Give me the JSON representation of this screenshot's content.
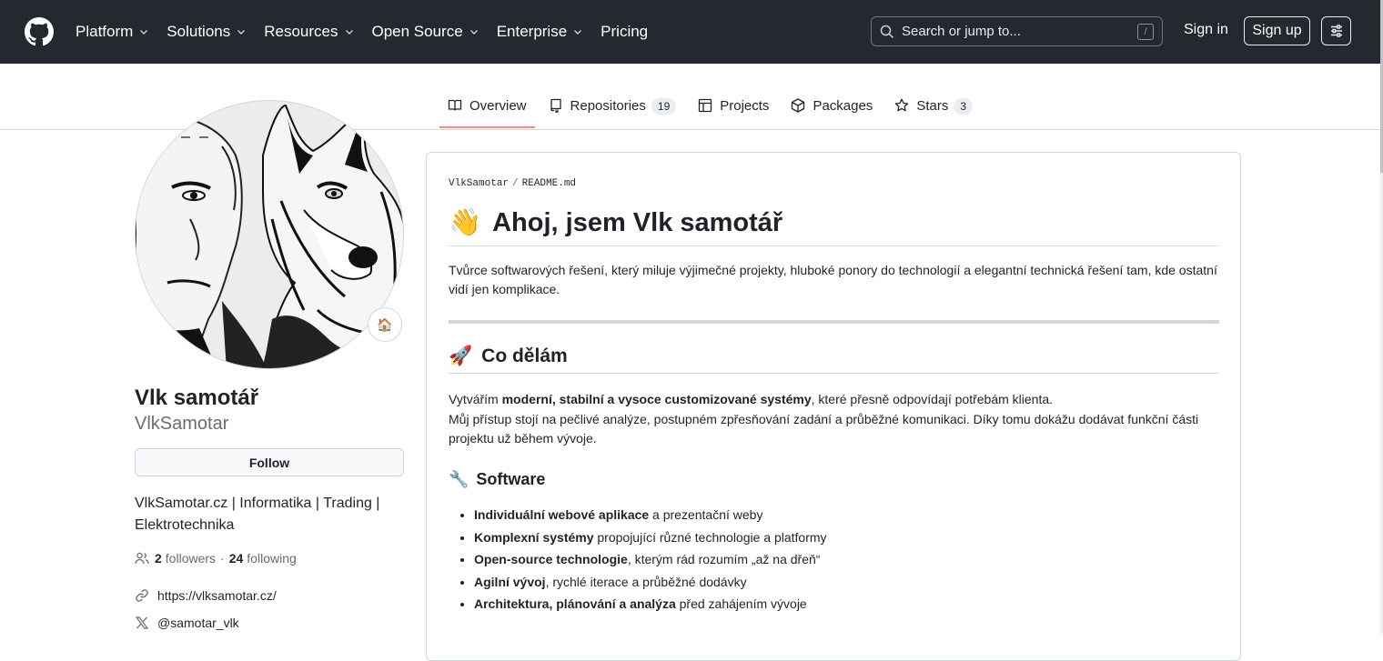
{
  "header": {
    "nav": [
      {
        "label": "Platform",
        "dropdown": true
      },
      {
        "label": "Solutions",
        "dropdown": true
      },
      {
        "label": "Resources",
        "dropdown": true
      },
      {
        "label": "Open Source",
        "dropdown": true
      },
      {
        "label": "Enterprise",
        "dropdown": true
      },
      {
        "label": "Pricing",
        "dropdown": false
      }
    ],
    "search_placeholder": "Search or jump to...",
    "search_shortcut": "/",
    "sign_in": "Sign in",
    "sign_up": "Sign up",
    "colors": {
      "bg": "#24292f",
      "text": "#ffffff"
    }
  },
  "tabs": [
    {
      "label": "Overview",
      "icon": "book-icon",
      "active": true,
      "count": ""
    },
    {
      "label": "Repositories",
      "icon": "repo-icon",
      "active": false,
      "count": "19"
    },
    {
      "label": "Projects",
      "icon": "table-icon",
      "active": false,
      "count": ""
    },
    {
      "label": "Packages",
      "icon": "package-icon",
      "active": false,
      "count": ""
    },
    {
      "label": "Stars",
      "icon": "star-icon",
      "active": false,
      "count": "3"
    }
  ],
  "profile": {
    "status_emoji": "🏠",
    "full_name": "Vlk samotář",
    "username": "VlkSamotar",
    "follow_label": "Follow",
    "bio": "VlkSamotar.cz | Informatika | Trading | Elektrotechnika",
    "followers_count": "2",
    "followers_label": "followers",
    "following_count": "24",
    "following_label": "following",
    "separator": "·",
    "website": "https://vlksamotar.cz/",
    "twitter": "@samotar_vlk"
  },
  "readme": {
    "owner": "VlkSamotar",
    "file": "README.md",
    "h1_emoji": "👋",
    "h1": "Ahoj, jsem Vlk samotář",
    "intro": "Tvůrce softwarových řešení, který miluje výjimečné projekty, hluboké ponory do technologií a elegantní technická řešení tam, kde ostatní vidí jen komplikace.",
    "h2_emoji": "🚀",
    "h2": "Co dělám",
    "p2": {
      "a": "Vytvářím ",
      "b": "moderní, stabilní a vysoce customizované systémy",
      "c": ", které přesně odpovídají potřebám klienta.",
      "d": "Můj přístup stojí na pečlivé analýze, postupném zpřesňování zadání a průběžné komunikaci. Díky tomu dokážu dodávat funkční části projektu už během vývoje."
    },
    "h3_emoji": "🔧",
    "h3": "Software",
    "list": [
      {
        "bold": "Individuální webové aplikace",
        "rest": " a prezentační weby"
      },
      {
        "bold": "Komplexní systémy",
        "rest": " propojující různé technologie a platformy"
      },
      {
        "bold": "Open-source technologie",
        "rest": ", kterým rád rozumím „až na dřeň“"
      },
      {
        "bold": "Agilní vývoj",
        "rest": ", rychlé iterace a průběžné dodávky"
      },
      {
        "bold": "Architektura, plánování a analýza",
        "rest": " před zahájením vývoje"
      }
    ]
  }
}
